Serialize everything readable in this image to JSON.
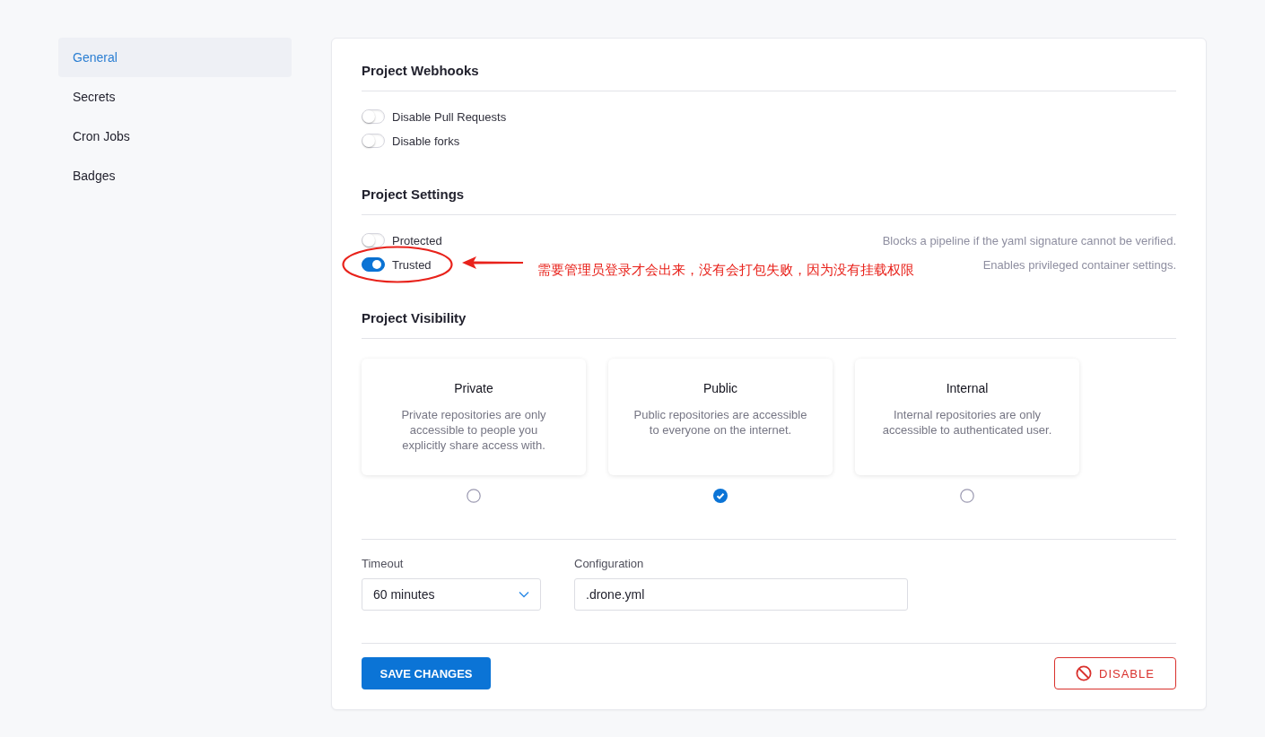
{
  "sidebar": {
    "items": [
      {
        "label": "General",
        "selected": true
      },
      {
        "label": "Secrets",
        "selected": false
      },
      {
        "label": "Cron Jobs",
        "selected": false
      },
      {
        "label": "Badges",
        "selected": false
      }
    ]
  },
  "webhooks": {
    "title": "Project Webhooks",
    "toggles": [
      {
        "label": "Disable Pull Requests",
        "on": false
      },
      {
        "label": "Disable forks",
        "on": false
      }
    ]
  },
  "settings": {
    "title": "Project Settings",
    "toggles": [
      {
        "label": "Protected",
        "on": false,
        "description": "Blocks a pipeline if the yaml signature cannot be verified."
      },
      {
        "label": "Trusted",
        "on": true,
        "description": "Enables privileged container settings."
      }
    ]
  },
  "annotation": {
    "text": "需要管理员登录才会出来，没有会打包失败，因为没有挂载权限"
  },
  "visibility": {
    "title": "Project Visibility",
    "options": [
      {
        "title": "Private",
        "description": "Private repositories are only accessible to people you explicitly share access with.",
        "selected": false
      },
      {
        "title": "Public",
        "description": "Public repositories are accessible to everyone on the internet.",
        "selected": true
      },
      {
        "title": "Internal",
        "description": "Internal repositories are only accessible to authenticated user.",
        "selected": false
      }
    ]
  },
  "timeout": {
    "label": "Timeout",
    "value": "60 minutes"
  },
  "configuration": {
    "label": "Configuration",
    "value": ".drone.yml"
  },
  "buttons": {
    "save": "SAVE CHANGES",
    "disable": "DISABLE"
  }
}
